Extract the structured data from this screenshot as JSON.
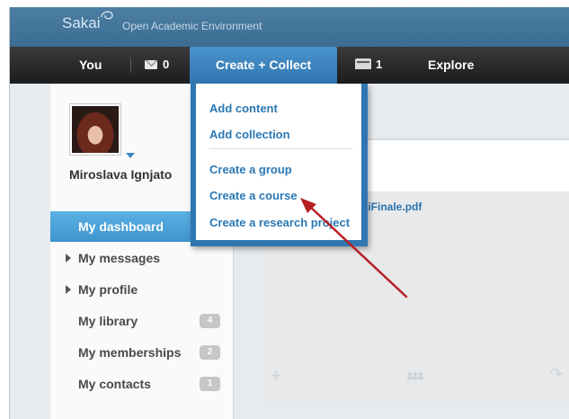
{
  "header": {
    "logo_text": "Sakai",
    "tagline": "Open Academic Environment"
  },
  "nav": {
    "you_label": "You",
    "messages_count": "0",
    "create_label": "Create + Collect",
    "inbox_count": "1",
    "explore_label": "Explore"
  },
  "create_menu": {
    "items": [
      {
        "label": "Add content"
      },
      {
        "label": "Add collection"
      },
      {
        "label": "Create a group"
      },
      {
        "label": "Create a course"
      },
      {
        "label": "Create a research project"
      }
    ]
  },
  "sidebar": {
    "user_name": "Miroslava Ignjato",
    "items": [
      {
        "label": "My dashboard",
        "active": true
      },
      {
        "label": "My messages",
        "expandable": true
      },
      {
        "label": "My profile",
        "expandable": true
      },
      {
        "label": "My library",
        "badge": "4"
      },
      {
        "label": "My memberships",
        "badge": "2"
      },
      {
        "label": "My contacts",
        "badge": "1"
      }
    ]
  },
  "main": {
    "file_link": "kaiFinale.pdf"
  },
  "colors": {
    "brand_blue": "#3c6c92",
    "menu_blue": "#3077b1",
    "active_blue": "#4ea3db",
    "annotation_red": "#b81f24"
  },
  "icons": {
    "messages": "envelope-icon",
    "inbox": "tray-icon",
    "avatar_menu": "chevron-down-icon",
    "expand": "triangle-right-icon",
    "add": "plus-icon",
    "share": "share-icon",
    "people": "people-icon",
    "annotation": "arrow-icon"
  }
}
